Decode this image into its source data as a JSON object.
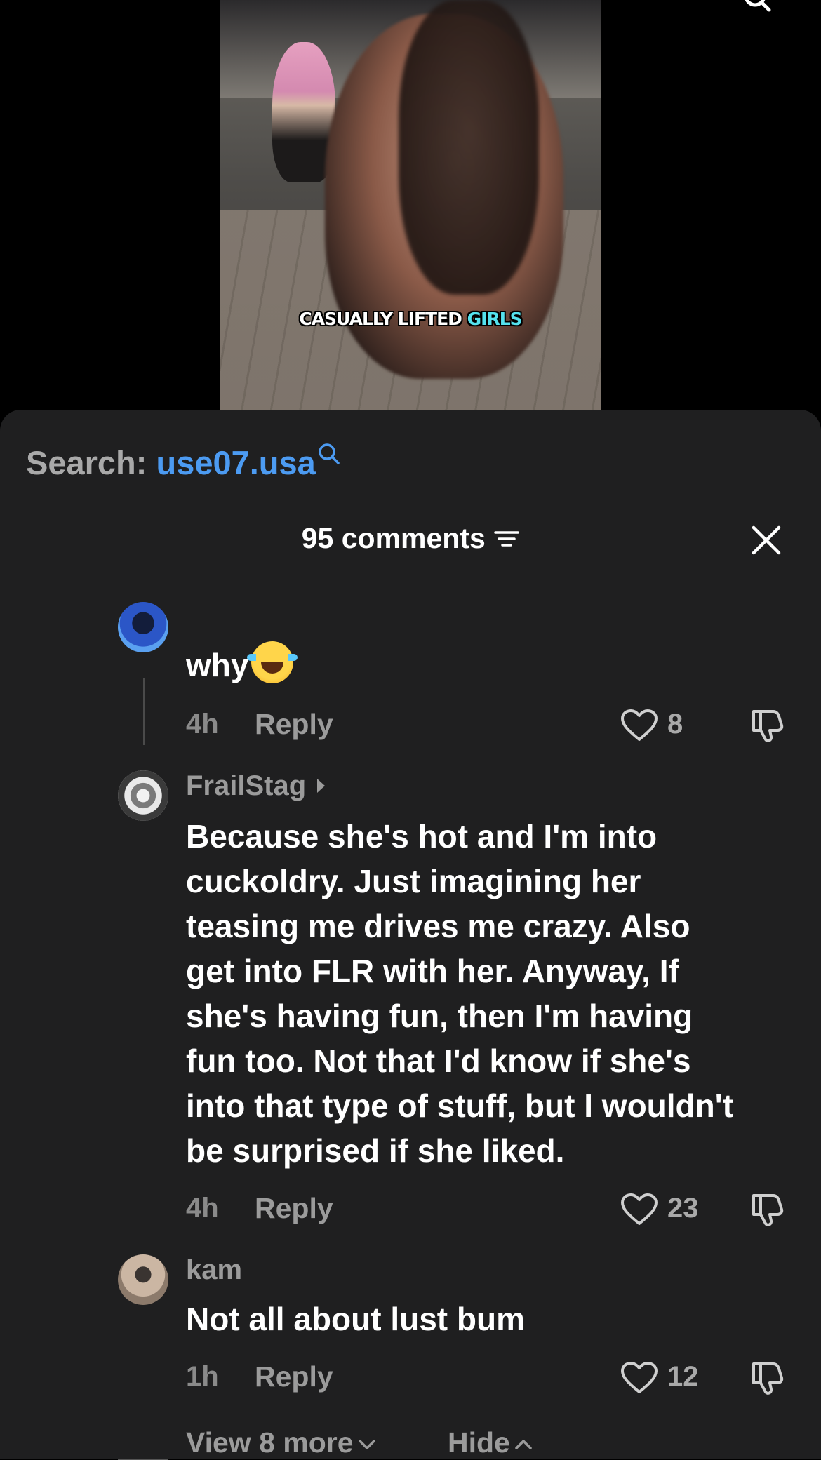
{
  "video": {
    "caption_white": "CASUALLY LIFTED",
    "caption_highlight": "GIRLS",
    "highlight_color": "#55e2ee"
  },
  "search": {
    "label": "Search:",
    "term": "use07.usa",
    "icon": "search-icon",
    "term_color": "#4c9bf2"
  },
  "comments": {
    "header": "95 comments",
    "sort_icon": "sort-icon",
    "close_icon": "close-icon",
    "items": [
      {
        "username": "",
        "text": "why",
        "emoji": "face-with-tears-of-joy",
        "time": "4h",
        "reply": "Reply",
        "likes": "8"
      },
      {
        "username": "FrailStag",
        "text_lines": [
          "Because she's hot and I'm into",
          "cuckoldry. Just imagining her",
          "teasing me drives me crazy. Also",
          "get into FLR with her. Anyway, If",
          "she's having fun, then I'm having",
          "fun too. Not that I'd know if she's",
          "into that type of stuff, but I wouldn't",
          "be surprised if she liked."
        ],
        "time": "4h",
        "reply": "Reply",
        "likes": "23"
      },
      {
        "username": "kam",
        "text": "Not all about lust bum",
        "time": "1h",
        "reply": "Reply",
        "likes": "12"
      }
    ],
    "view_more": "View 8 more",
    "hide": "Hide"
  }
}
